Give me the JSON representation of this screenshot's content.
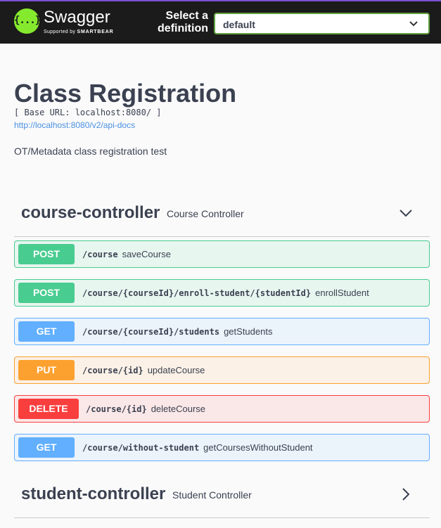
{
  "topbar": {
    "brand_name": "Swagger",
    "brand_sub_prefix": "Supported by",
    "brand_sub_company": "SMARTBEAR",
    "logo_glyph": "{...}",
    "select_label": "Select a definition",
    "definition_value": "default",
    "accent_color": "#85ea2d"
  },
  "info": {
    "title": "Class Registration",
    "base_url": "[ Base URL: localhost:8080/ ]",
    "spec_link": "http://localhost:8080/v2/api-docs",
    "description": "OT/Metadata class registration test"
  },
  "tags": [
    {
      "name": "course-controller",
      "description": "Course Controller",
      "toggle_icon": "chevron-down-icon",
      "operations": [
        {
          "method": "POST",
          "path": "/course",
          "summary": "saveCourse"
        },
        {
          "method": "POST",
          "path": "/course/{courseId}/enroll-student/{studentId}",
          "summary": "enrollStudent"
        },
        {
          "method": "GET",
          "path": "/course/{courseId}/students",
          "summary": "getStudents"
        },
        {
          "method": "PUT",
          "path": "/course/{id}",
          "summary": "updateCourse"
        },
        {
          "method": "DELETE",
          "path": "/course/{id}",
          "summary": "deleteCourse"
        },
        {
          "method": "GET",
          "path": "/course/without-student",
          "summary": "getCoursesWithoutStudent"
        }
      ]
    },
    {
      "name": "student-controller",
      "description": "Student Controller",
      "toggle_icon": "chevron-right-icon"
    }
  ],
  "method_colors": {
    "POST": "#49cc90",
    "GET": "#61affe",
    "PUT": "#fca130",
    "DELETE": "#f93e3e"
  }
}
